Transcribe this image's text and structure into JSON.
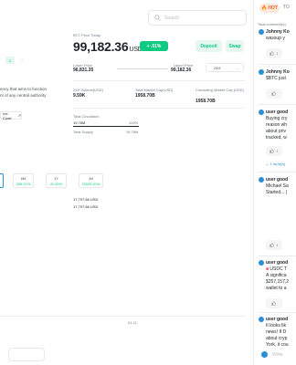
{
  "search": {
    "placeholder": "Search"
  },
  "price_card": {
    "label": "BTC Price Today",
    "price": "99,182.36",
    "currency": "USD",
    "change": "+ .01%",
    "deposit_label": "Deposit",
    "swap_label": "Swap",
    "lower_price_label": "Lower Price",
    "lower_price": "96,831.35",
    "upper_price_label": "Upper Price",
    "upper_price": "99,182.36",
    "timeframe": "24H"
  },
  "stats": {
    "volume_label": "24H Volume(USD)",
    "volume": "9.59K",
    "mcap_label": "Total Market Cap(USD)",
    "mcap": "1958.70B",
    "circ_label": "Circulating Market Cap (USD)",
    "circ": "1958.70B",
    "circulation_label": "Total Circulation",
    "circulation": "19.78M",
    "circulation_pct": "100%",
    "supply_label": "Total Supply",
    "supply": "19.78M"
  },
  "about": {
    "badge": "2",
    "line1": "ency that aims to function",
    "line2": "nt of any central authority",
    "source_code": "rce Code"
  },
  "performance": [
    {
      "period": "6M",
      "value": "326.07%"
    },
    {
      "period": "1Y",
      "value": "41.90%"
    },
    {
      "period": "All",
      "value": "75205.51%"
    }
  ],
  "history_prices": [
    "17,797.86 USD",
    "17,797.86 USD"
  ],
  "chart_axis_label": "01-11",
  "comments_panel": {
    "tab_hot": "HOT",
    "tab_top": "TO",
    "total_comments": "Total comment(s)",
    "comments": [
      {
        "user": "Johnny Ko",
        "lines": [
          "wassup y"
        ],
        "likes": "1"
      },
      {
        "user": "Johnny Ko",
        "lines": [
          "$BTC just"
        ],
        "likes": ""
      },
      {
        "user": "user good",
        "lines": [
          "Buying cry",
          "reason wh",
          "about priv",
          "tracked, w"
        ],
        "likes": "1",
        "reply": "1 reply(s)"
      },
      {
        "user": "user good",
        "lines": [
          "Michael Sa",
          "Started... ("
        ],
        "likes": "1"
      },
      {
        "user": "user good",
        "lines": [
          "USDC T",
          "A significa",
          "$257,157,2",
          "wallet to a"
        ],
        "likes": ""
      },
      {
        "user": "user good",
        "lines": [
          "It looks lik",
          "news! If D",
          "about cryp",
          "York, it cou"
        ],
        "likes": ""
      }
    ],
    "write_placeholder": "Write"
  },
  "colors": {
    "green": "#0ecb81",
    "hot": "#f0633b",
    "blue": "#2b8fd6",
    "text": "#1e2329",
    "muted": "#707a8a"
  }
}
